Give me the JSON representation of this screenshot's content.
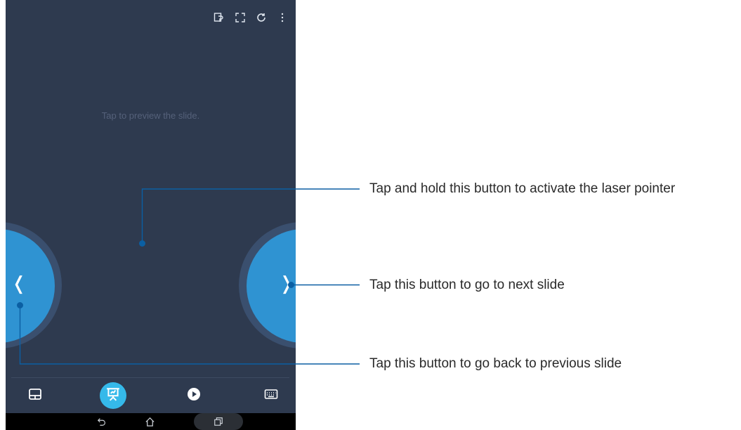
{
  "screen": {
    "preview_text": "Tap to preview the slide.",
    "topbar_icons": [
      "presenter-notes-icon",
      "fullscreen-icon",
      "refresh-icon",
      "more-vert-icon"
    ]
  },
  "slide_buttons": {
    "prev_glyph": "❬",
    "next_glyph": "❭"
  },
  "bottom_nav": {
    "items": [
      "touchpad-icon",
      "presentation-icon",
      "play-icon",
      "keyboard-icon"
    ],
    "active_index": 1,
    "active_color": "#35b9ea"
  },
  "system_bar": {
    "icons": [
      "back-icon",
      "home-icon",
      "recent-apps-icon"
    ]
  },
  "colors": {
    "screen_bg": "#2e3a4f",
    "button_core": "#2f93d2",
    "button_ring": "#3a4f6e",
    "callout_line": "#0b5fa3"
  },
  "callouts": {
    "laser": "Tap and hold this button to activate the laser pointer",
    "next": "Tap this button to go to next slide",
    "prev": "Tap this button to go back to previous slide"
  }
}
